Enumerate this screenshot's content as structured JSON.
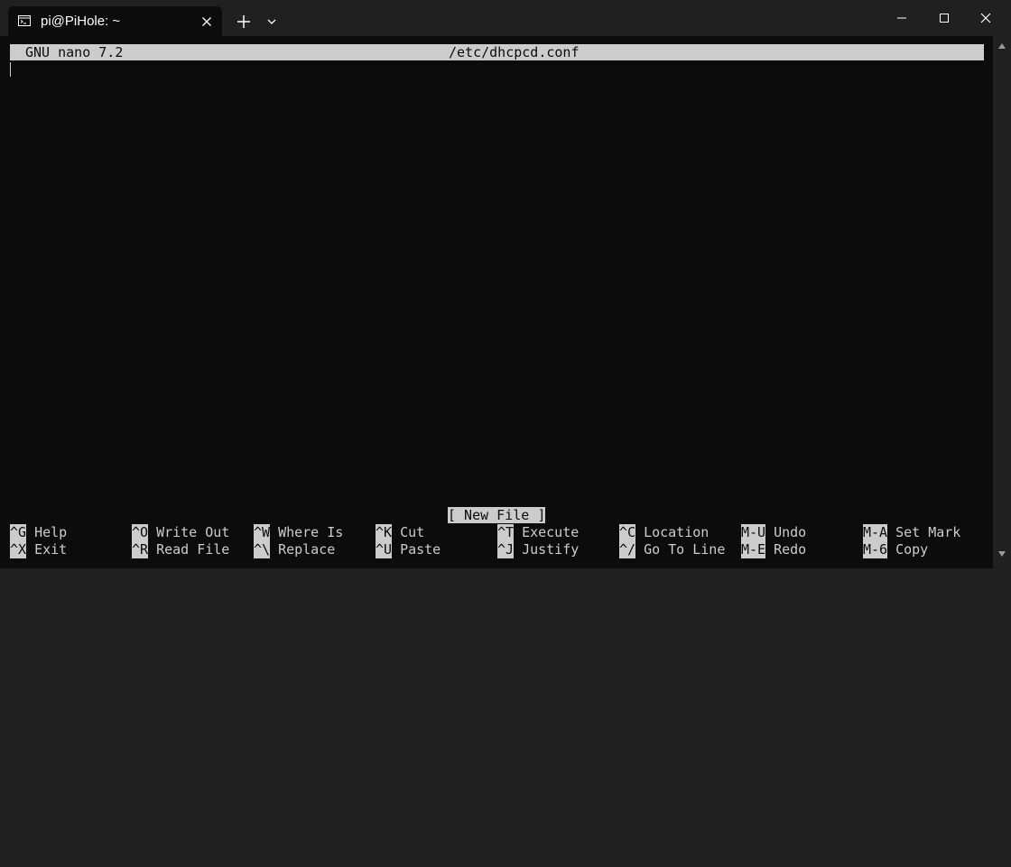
{
  "window": {
    "tab_title": "pi@PiHole: ~",
    "tab_icon": "terminal-icon",
    "new_tab_icon": "plus-icon",
    "dropdown_icon": "chevron-down-icon",
    "minimize_icon": "minimize-icon",
    "maximize_icon": "maximize-icon",
    "close_icon": "close-icon"
  },
  "nano": {
    "version": "GNU nano 7.2",
    "filename": "/etc/dhcpcd.conf",
    "status": "[ New File ]",
    "shortcuts_row1": [
      {
        "key": "^G",
        "label": "Help"
      },
      {
        "key": "^O",
        "label": "Write Out"
      },
      {
        "key": "^W",
        "label": "Where Is"
      },
      {
        "key": "^K",
        "label": "Cut"
      },
      {
        "key": "^T",
        "label": "Execute"
      },
      {
        "key": "^C",
        "label": "Location"
      },
      {
        "key": "M-U",
        "label": "Undo"
      },
      {
        "key": "M-A",
        "label": "Set Mark"
      }
    ],
    "shortcuts_row2": [
      {
        "key": "^X",
        "label": "Exit"
      },
      {
        "key": "^R",
        "label": "Read File"
      },
      {
        "key": "^\\",
        "label": "Replace"
      },
      {
        "key": "^U",
        "label": "Paste"
      },
      {
        "key": "^J",
        "label": "Justify"
      },
      {
        "key": "^/",
        "label": "Go To Line"
      },
      {
        "key": "M-E",
        "label": "Redo"
      },
      {
        "key": "M-6",
        "label": "Copy"
      }
    ]
  },
  "colors": {
    "terminal_bg": "#0c0c0c",
    "terminal_fg": "#cccccc",
    "titlebar_bg": "#202020"
  }
}
